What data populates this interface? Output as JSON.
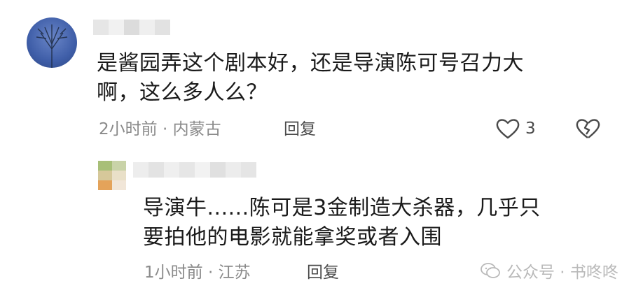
{
  "comment": {
    "text_line1": "是酱园弄这个剧本好，还是导演陈可号召力大",
    "text_line2": "啊，这么多人么？",
    "meta": "2小时前 · 内蒙古",
    "reply_label": "回复",
    "like_count": "3"
  },
  "reply": {
    "text_line1": "导演牛......陈可是3金制造大杀器，几乎只",
    "text_line2": "要拍他的电影就能拿奖或者入围",
    "meta": "1小时前 · 江苏",
    "reply_label": "回复"
  },
  "watermark": {
    "text": "公众号 · 书咚咚"
  },
  "icons": [
    "heart-outline-icon",
    "broken-heart-icon",
    "wechat-icon"
  ]
}
